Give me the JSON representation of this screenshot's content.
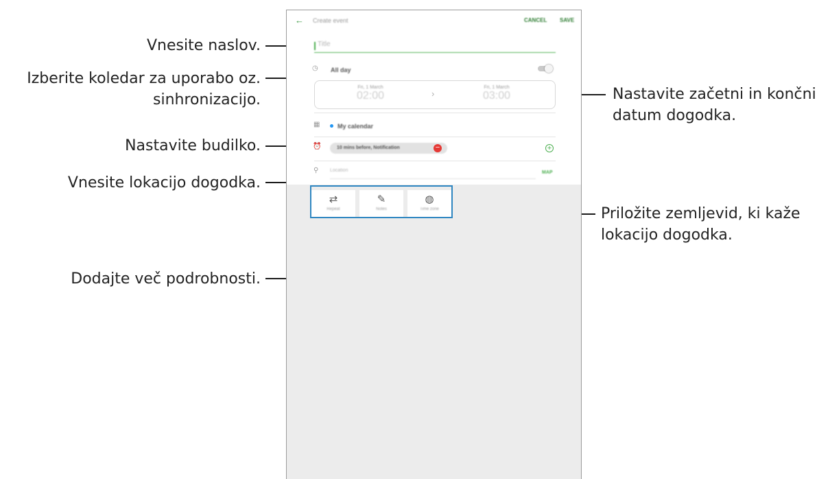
{
  "callouts": {
    "title": "Vnesite naslov.",
    "calendar_line1": "Izberite koledar za uporabo oz.",
    "calendar_line2": "sinhronizacijo.",
    "alarm": "Nastavite budilko.",
    "location": "Vnesite lokacijo dogodka.",
    "details": "Dodajte več podrobnosti.",
    "dates_line1": "Nastavite začetni in končni",
    "dates_line2": "datum dogodka.",
    "map_line1": "Priložite zemljevid, ki kaže",
    "map_line2": "lokacijo dogodka."
  },
  "screen": {
    "header": {
      "title": "Create event",
      "cancel": "CANCEL",
      "save": "SAVE",
      "back_icon": "back-arrow-icon"
    },
    "title_placeholder": "Title",
    "all_day_label": "All day",
    "start": {
      "date": "Fri, 1 March",
      "time": "02:00"
    },
    "end": {
      "date": "Fri, 1 March",
      "time": "03:00"
    },
    "calendar_name": "My calendar",
    "reminder": "10 mins before, Notification",
    "location_placeholder": "Location",
    "map_label": "MAP",
    "detail_buttons": [
      {
        "label": "Repeat",
        "icon": "repeat-icon"
      },
      {
        "label": "Notes",
        "icon": "notes-icon"
      },
      {
        "label": "Time zone",
        "icon": "time-zone-icon"
      }
    ]
  },
  "colors": {
    "accent": "#4caf50",
    "highlight_border": "#2e86c1",
    "remove": "#e53935",
    "calendar_dot": "#2196f3"
  }
}
